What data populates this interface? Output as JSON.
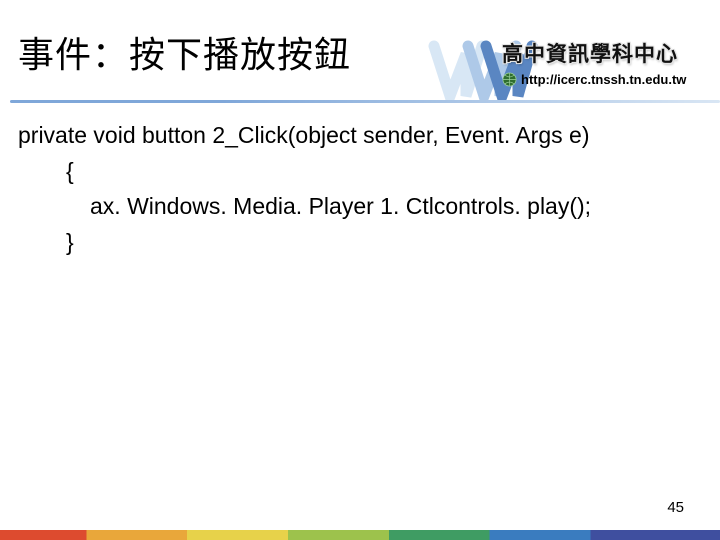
{
  "header": {
    "title": "事件：按下播放按鈕",
    "brand": "高中資訊學科中心",
    "url": "http://icerc.tnssh.tn.edu.tw"
  },
  "code": {
    "l1": "private void button 2_Click(object sender, Event. Args e)",
    "l2": "{",
    "l3": "ax. Windows. Media. Player 1. Ctlcontrols. play();",
    "l4": "}"
  },
  "page_number": "45"
}
